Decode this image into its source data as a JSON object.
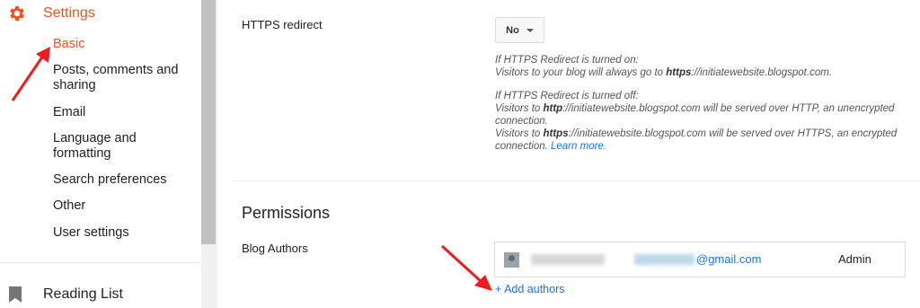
{
  "sidebar": {
    "settings_label": "Settings",
    "items": [
      {
        "label": "Basic",
        "active": true
      },
      {
        "label": "Posts, comments and sharing"
      },
      {
        "label": "Email"
      },
      {
        "label": "Language and formatting"
      },
      {
        "label": "Search preferences"
      },
      {
        "label": "Other"
      },
      {
        "label": "User settings"
      }
    ],
    "reading_list_label": "Reading List"
  },
  "https": {
    "label": "HTTPS redirect",
    "select_value": "No",
    "on_heading": "If HTTPS Redirect is turned on:",
    "on_text_pre": "Visitors to your blog will always go to ",
    "on_text_bold": "https",
    "on_text_post": "://initiatewebsite.blogspot.com.",
    "off_heading": "If HTTPS Redirect is turned off:",
    "off_line1_pre": "Visitors to ",
    "off_line1_bold": "http",
    "off_line1_post": "://initiatewebsite.blogspot.com will be served over HTTP, an unencrypted connection.",
    "off_line2_pre": "Visitors to ",
    "off_line2_bold": "https",
    "off_line2_post": "://initiatewebsite.blogspot.com will be served over HTTPS, an encrypted connection. ",
    "learn_more": "Learn more."
  },
  "permissions": {
    "title": "Permissions",
    "blog_authors_label": "Blog Authors",
    "author_email_domain": "@gmail.com",
    "author_role": "Admin",
    "add_authors": "+ Add authors"
  },
  "colors": {
    "accent": "#f4511e",
    "link": "#1a73e8",
    "annotation_arrow": "#ee1c1c"
  }
}
